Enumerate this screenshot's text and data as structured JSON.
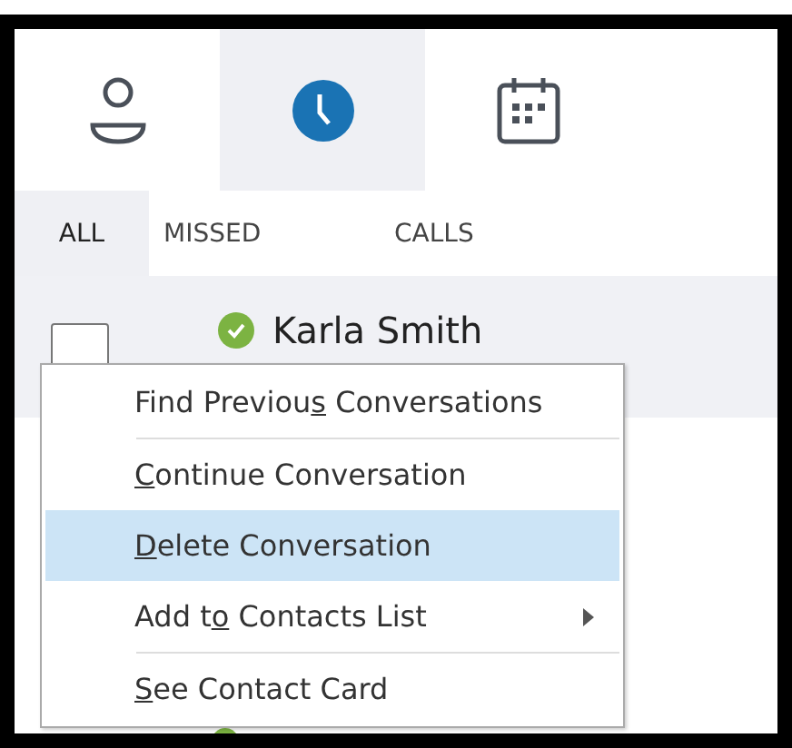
{
  "nav_tabs": [
    {
      "kind": "contacts",
      "selected": false
    },
    {
      "kind": "recent",
      "selected": true
    },
    {
      "kind": "calendar",
      "selected": false
    }
  ],
  "filter_tabs": [
    {
      "label": "ALL",
      "selected": true
    },
    {
      "label": "MISSED",
      "selected": false
    },
    {
      "label": "CALLS",
      "selected": false
    }
  ],
  "conversations": [
    {
      "name": "Karla Smith",
      "checked": false,
      "color": "#7cb342"
    }
  ],
  "context_menu": [
    {
      "before": "Find Previou",
      "key": "s",
      "after": " Conversations",
      "selected": false,
      "submenu": false,
      "separator_after": true
    },
    {
      "key": "C",
      "after": "ontinue Conversation",
      "selected": false,
      "submenu": false,
      "separator_after": false
    },
    {
      "key": "D",
      "after": "elete Conversation",
      "selected": true,
      "submenu": false,
      "separator_after": false
    },
    {
      "before": "Add t",
      "key": "o",
      "after": " Contacts List",
      "selected": false,
      "submenu": true,
      "separator_after": true
    },
    {
      "key": "S",
      "after": "ee Contact Card",
      "selected": false,
      "submenu": false,
      "separator_after": false
    }
  ],
  "next_row": {
    "color": "#7cb342"
  }
}
